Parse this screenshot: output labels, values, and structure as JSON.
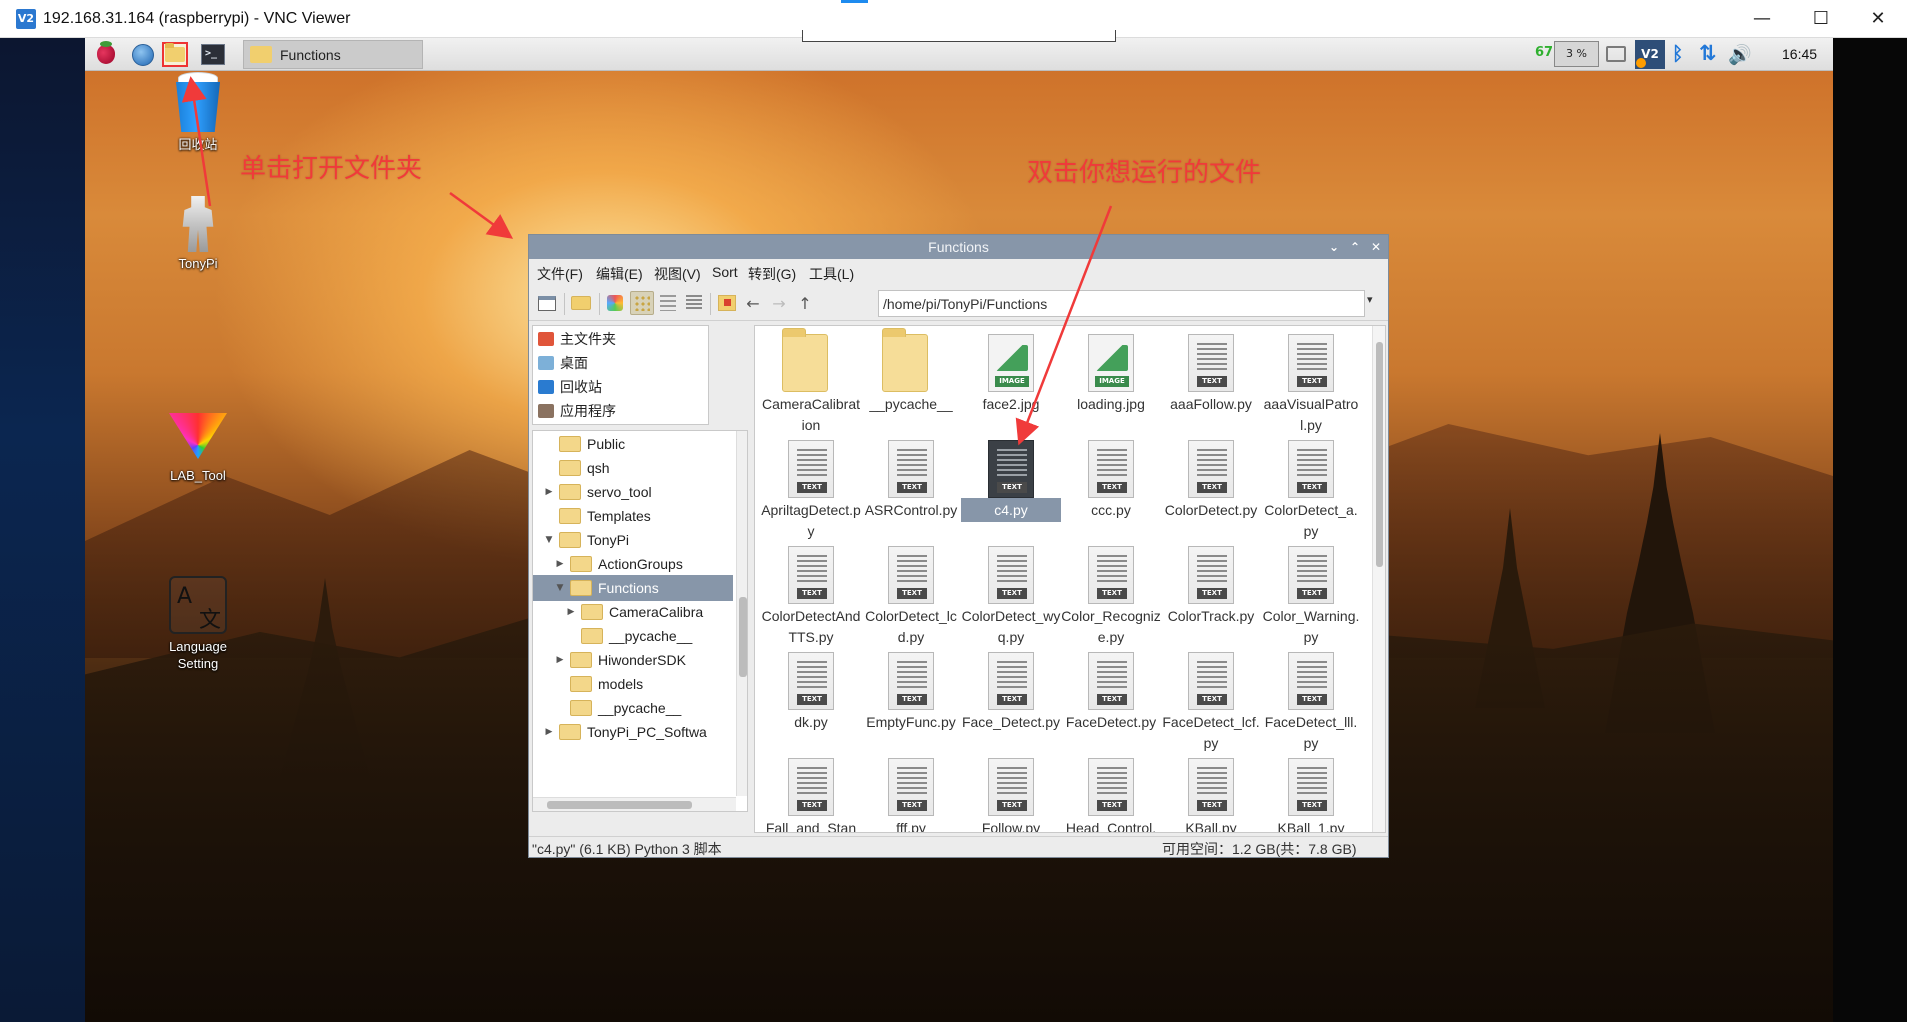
{
  "vnc": {
    "logo": "V2",
    "title": "192.168.31.164 (raspberrypi) - VNC Viewer",
    "minimize": "—",
    "maximize": "☐",
    "close": "✕"
  },
  "taskbar": {
    "launchers": [
      "raspberry-menu-icon",
      "web-browser-icon",
      "file-manager-icon",
      "terminal-icon"
    ],
    "terminal_glyph": ">_",
    "task_label": "Functions",
    "cpu_temp": "67",
    "cpu_usage": "3 %",
    "vnc_label": "V2",
    "bluetooth_glyph": "ᛒ",
    "network_glyph": "⇅",
    "volume_glyph": "🔊",
    "clock": "16:45"
  },
  "desktop": {
    "icons": [
      {
        "label": "回收站"
      },
      {
        "label": "TonyPi"
      },
      {
        "label": "LAB_Tool"
      },
      {
        "label": "Language Setting",
        "glyph_a": "A",
        "glyph_b": "文"
      }
    ],
    "annotations": {
      "left": "单击打开文件夹",
      "right": "双击你想运行的文件"
    }
  },
  "file_manager": {
    "title": "Functions",
    "controls": {
      "minimize": "⌄",
      "maximize": "⌃",
      "close": "✕"
    },
    "menu": [
      "文件(F)",
      "编辑(E)",
      "视图(V)",
      "Sort",
      "转到(G)",
      "工具(L)"
    ],
    "toolbar": {
      "back_glyph": "←",
      "forward_glyph": "→",
      "up_glyph": "↑",
      "path": "/home/pi/TonyPi/Functions",
      "dropdown_glyph": "▾"
    },
    "places": [
      {
        "label": "主文件夹",
        "color": "#e0553a"
      },
      {
        "label": "桌面",
        "color": "#7db0d8"
      },
      {
        "label": "回收站",
        "color": "#2a7bd0"
      },
      {
        "label": "应用程序",
        "color": "#8a7260"
      }
    ],
    "tree": [
      {
        "label": "Public",
        "expander": ""
      },
      {
        "label": "qsh",
        "expander": ""
      },
      {
        "label": "servo_tool",
        "expander": "▶"
      },
      {
        "label": "Templates",
        "expander": ""
      },
      {
        "label": "TonyPi",
        "expander": "▼"
      },
      {
        "label": "ActionGroups",
        "expander": "▶"
      },
      {
        "label": "Functions",
        "expander": "▼",
        "selected": true
      },
      {
        "label": "CameraCalibra",
        "expander": "▶"
      },
      {
        "label": "__pycache__",
        "expander": ""
      },
      {
        "label": "HiwonderSDK",
        "expander": "▶"
      },
      {
        "label": "models",
        "expander": ""
      },
      {
        "label": "__pycache__",
        "expander": ""
      },
      {
        "label": "TonyPi_PC_Softwa",
        "expander": "▶"
      }
    ],
    "files": [
      {
        "name": "CameraCalibration",
        "type": "folder"
      },
      {
        "name": "__pycache__",
        "type": "folder"
      },
      {
        "name": "face2.jpg",
        "type": "image"
      },
      {
        "name": "loading.jpg",
        "type": "image"
      },
      {
        "name": "aaaFollow.py",
        "type": "text"
      },
      {
        "name": "aaaVisualPatrol.py",
        "type": "text"
      },
      {
        "name": "ApriltagDetect.py",
        "type": "text"
      },
      {
        "name": "ASRControl.py",
        "type": "text"
      },
      {
        "name": "c4.py",
        "type": "text",
        "selected": true
      },
      {
        "name": "ccc.py",
        "type": "text"
      },
      {
        "name": "ColorDetect.py",
        "type": "text"
      },
      {
        "name": "ColorDetect_a.py",
        "type": "text"
      },
      {
        "name": "ColorDetectAndTTS.py",
        "type": "text"
      },
      {
        "name": "ColorDetect_lcd.py",
        "type": "text"
      },
      {
        "name": "ColorDetect_wyq.py",
        "type": "text"
      },
      {
        "name": "Color_Recognize.py",
        "type": "text"
      },
      {
        "name": "ColorTrack.py",
        "type": "text"
      },
      {
        "name": "Color_Warning.py",
        "type": "text"
      },
      {
        "name": "dk.py",
        "type": "text"
      },
      {
        "name": "EmptyFunc.py",
        "type": "text"
      },
      {
        "name": "Face_Detect.py",
        "type": "text"
      },
      {
        "name": "FaceDetect.py",
        "type": "text"
      },
      {
        "name": "FaceDetect_lcf.py",
        "type": "text"
      },
      {
        "name": "FaceDetect_lll.py",
        "type": "text"
      },
      {
        "name": "Fall_and_Stan",
        "type": "text"
      },
      {
        "name": "fff.py",
        "type": "text"
      },
      {
        "name": "Follow.py",
        "type": "text"
      },
      {
        "name": "Head_Control.",
        "type": "text"
      },
      {
        "name": "KBall.py",
        "type": "text"
      },
      {
        "name": "KBall_1.py",
        "type": "text"
      }
    ],
    "status": {
      "left": "\"c4.py\" (6.1 KB) Python 3 脚本",
      "right": "可用空间：1.2 GB(共：7.8 GB)"
    }
  },
  "colors": {
    "annotation_red": "#f03a3a",
    "selection": "#8796a9",
    "cpu_green": "#2fb02f",
    "accent_blue": "#2278d8"
  }
}
